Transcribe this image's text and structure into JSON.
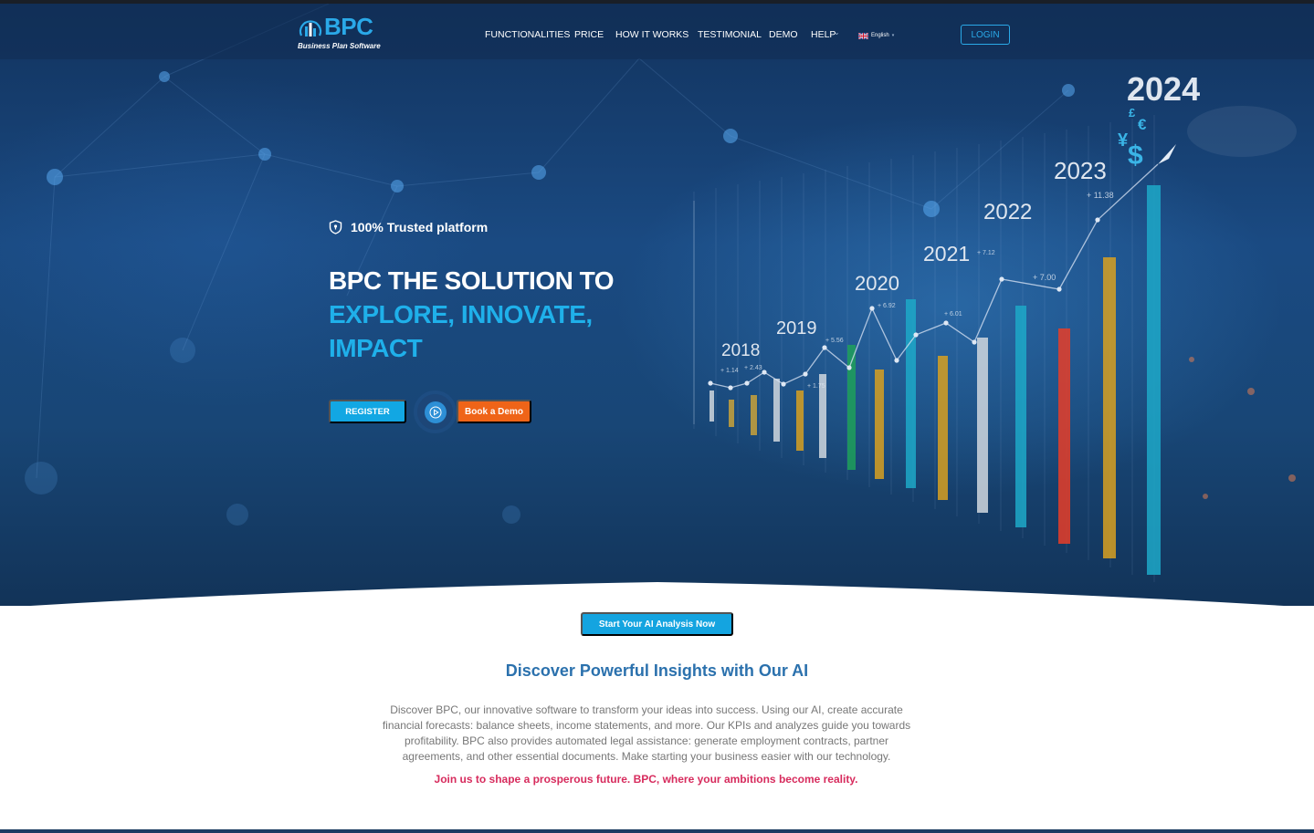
{
  "brand": {
    "name": "BPC",
    "subtitle": "Business Plan Software",
    "accent_color": "#2aa9e8"
  },
  "nav": {
    "items": [
      {
        "label": "FUNCTIONALITIES"
      },
      {
        "label": "PRICE"
      },
      {
        "label": "HOW IT WORKS"
      },
      {
        "label": "TESTIMONIAL"
      },
      {
        "label": "DEMO"
      },
      {
        "label": "HELP"
      }
    ],
    "language": "English",
    "login_label": "LOGIN"
  },
  "hero": {
    "trust_label": "100% Trusted platform",
    "headline_line1": "BPC THE SOLUTION TO",
    "headline_line2": "EXPLORE, INNOVATE,",
    "headline_line3": "IMPACT",
    "register_label": "REGISTER",
    "demo_label": "Book a Demo",
    "illustration": {
      "years": [
        "2018",
        "2019",
        "2020",
        "2021",
        "2022",
        "2023",
        "2024"
      ],
      "growth_labels": [
        "+ 1.14",
        "+ 2.43",
        "+ 1.75",
        "+ 5.56",
        "+ 6.92",
        "+ 6.01",
        "+ 7.12",
        "+ 7.00",
        "+ 11.38"
      ],
      "currency_symbols": [
        "£",
        "€",
        "¥",
        "$"
      ],
      "bar_colors": [
        "#c9a23a",
        "#d7a021",
        "#1fa05a",
        "#1da8c8",
        "#e06a2a",
        "#d0d7de",
        "#e63d28"
      ]
    }
  },
  "insights": {
    "cta_label": "Start Your AI Analysis Now",
    "title": "Discover Powerful Insights with Our AI",
    "body_line1": "Discover BPC, our innovative software to transform your ideas into success. Using our AI, create accurate",
    "body_line2": "financial forecasts: balance sheets, income statements, and more. Our KPIs and analyzes guide you towards",
    "body_line3": "profitability. BPC also provides automated legal assistance: generate employment contracts, partner",
    "body_line4": "agreements, and other essential documents. Make starting your business easier with our technology.",
    "tagline": "Join us to shape a prosperous future. BPC, where your ambitions become reality."
  }
}
